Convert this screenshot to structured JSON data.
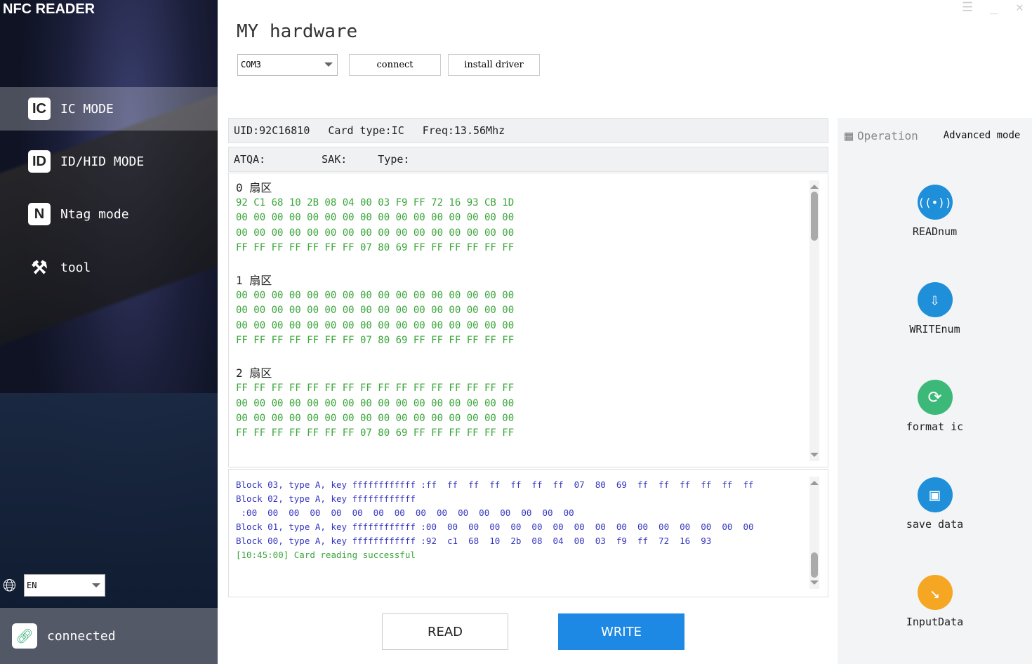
{
  "app_title": "NFC READER",
  "nav": [
    {
      "icon": "IC",
      "label": "IC MODE"
    },
    {
      "icon": "ID",
      "label": "ID/HID MODE"
    },
    {
      "icon": "N",
      "label": "Ntag mode"
    },
    {
      "icon": "⚒",
      "label": "tool"
    }
  ],
  "language": "EN",
  "status": "connected",
  "main_title": "MY hardware",
  "port": "COM3",
  "connect_label": "connect",
  "install_label": "install driver",
  "card": {
    "uid": "UID:92C16810",
    "type": "Card type:IC",
    "freq": "Freq:13.56Mhz",
    "atqa": "ATQA:",
    "sak": "SAK:",
    "ctype": "Type:"
  },
  "sectors": [
    {
      "label": "0 扇区",
      "rows": [
        "92 C1 68 10 2B 08 04 00 03 F9 FF 72 16 93 CB 1D",
        "00 00 00 00 00 00 00 00 00 00 00 00 00 00 00 00",
        "00 00 00 00 00 00 00 00 00 00 00 00 00 00 00 00",
        "FF FF FF FF FF FF FF 07 80 69 FF FF FF FF FF FF"
      ]
    },
    {
      "label": "1 扇区",
      "rows": [
        "00 00 00 00 00 00 00 00 00 00 00 00 00 00 00 00",
        "00 00 00 00 00 00 00 00 00 00 00 00 00 00 00 00",
        "00 00 00 00 00 00 00 00 00 00 00 00 00 00 00 00",
        "FF FF FF FF FF FF FF 07 80 69 FF FF FF FF FF FF"
      ]
    },
    {
      "label": "2 扇区",
      "rows": [
        "FF FF FF FF FF FF FF FF FF FF FF FF FF FF FF FF",
        "00 00 00 00 00 00 00 00 00 00 00 00 00 00 00 00",
        "00 00 00 00 00 00 00 00 00 00 00 00 00 00 00 00",
        "FF FF FF FF FF FF FF 07 80 69 FF FF FF FF FF FF"
      ]
    }
  ],
  "log": [
    "Block 03, type A, key ffffffffffff :ff  ff  ff  ff  ff  ff  ff  07  80  69  ff  ff  ff  ff  ff  ff",
    "Block 02, type A, key ffffffffffff",
    " :00  00  00  00  00  00  00  00  00  00  00  00  00  00  00  00",
    "Block 01, type A, key ffffffffffff :00  00  00  00  00  00  00  00  00  00  00  00  00  00  00  00",
    "Block 00, type A, key ffffffffffff :92  c1  68  10  2b  08  04  00  03  f9  ff  72  16  93",
    "[10:45:00] Card reading successful"
  ],
  "read_label": "READ",
  "write_label": "WRITE",
  "panel": {
    "title": "Operation",
    "advanced": "Advanced mode",
    "ops": [
      {
        "label": "READnum",
        "color": "#1e8fd8",
        "icon": "((•))"
      },
      {
        "label": "WRITEnum",
        "color": "#1e8fd8",
        "icon": "⇩"
      },
      {
        "label": "format ic",
        "color": "#3cb878",
        "icon": "⟳"
      },
      {
        "label": "save data",
        "color": "#1e8fd8",
        "icon": "▣"
      },
      {
        "label": "InputData",
        "color": "#f5a623",
        "icon": "↘"
      }
    ]
  }
}
